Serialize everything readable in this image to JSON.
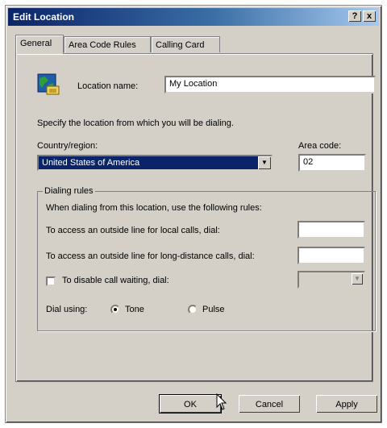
{
  "window": {
    "title": "Edit Location",
    "help_button": "?",
    "close_button": "x"
  },
  "tabs": [
    {
      "label": "General",
      "active": true
    },
    {
      "label": "Area Code Rules",
      "active": false
    },
    {
      "label": "Calling Card",
      "active": false
    }
  ],
  "general": {
    "location_name_label": "Location name:",
    "location_name_value": "My Location",
    "instruction": "Specify the location from which you will be dialing.",
    "country_label": "Country/region:",
    "country_value": "United States of America",
    "area_code_label": "Area code:",
    "area_code_value": "02"
  },
  "dialing_rules": {
    "group_label": "Dialing rules",
    "intro": "When dialing from this location, use the following rules:",
    "local_label": "To access an outside line for local calls, dial:",
    "local_value": "",
    "long_distance_label": "To access an outside line for long-distance calls, dial:",
    "long_distance_value": "",
    "call_waiting_label": "To disable call waiting, dial:",
    "call_waiting_checked": false,
    "call_waiting_value": "",
    "dial_using_label": "Dial using:",
    "tone_label": "Tone",
    "pulse_label": "Pulse",
    "selected": "Tone"
  },
  "buttons": {
    "ok": "OK",
    "cancel": "Cancel",
    "apply": "Apply"
  },
  "colors": {
    "titlebar": "#0a246a",
    "face": "#d4d0c8",
    "selection": "#0a246a"
  }
}
